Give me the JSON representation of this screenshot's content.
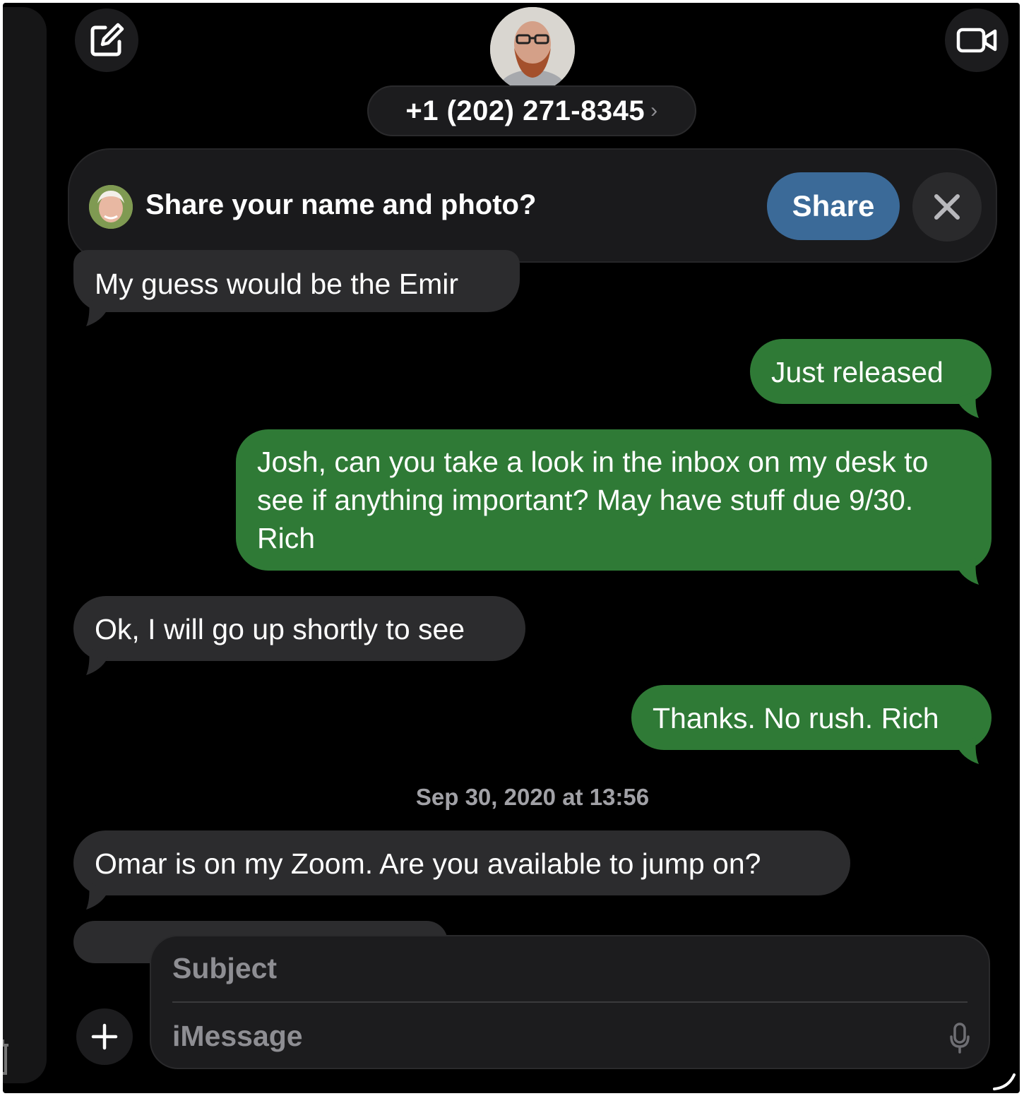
{
  "header": {
    "contact": "+1 (202) 271-8345",
    "chevron": "›",
    "icons": {
      "compose": "compose-icon",
      "video": "video-camera-icon"
    }
  },
  "share_banner": {
    "prompt": "Share your name and photo?",
    "share_label": "Share",
    "dismiss_icon": "close-icon"
  },
  "messages": [
    {
      "direction": "incoming",
      "text": "My guess would be the Emir"
    },
    {
      "direction": "outgoing",
      "text": "Just released"
    },
    {
      "direction": "outgoing",
      "text": "Josh, can you take a look in the inbox on my desk to see if anything important? May have stuff due 9/30. Rich"
    },
    {
      "direction": "incoming",
      "text": "Ok, I will go up shortly to see"
    },
    {
      "direction": "outgoing",
      "text": "Thanks. No rush. Rich"
    },
    {
      "direction": "incoming",
      "text": "Omar is on my Zoom. Are you available to jump on?"
    }
  ],
  "timestamp": "Sep 30, 2020 at 13:56",
  "composer": {
    "subject_placeholder": "Subject",
    "message_placeholder": "iMessage",
    "add_icon": "plus-icon",
    "mic_icon": "microphone-icon"
  },
  "colors": {
    "background": "#000000",
    "incoming_bubble": "#2c2c2e",
    "outgoing_bubble": "#2f7a36",
    "share_button": "#3b6a98"
  }
}
